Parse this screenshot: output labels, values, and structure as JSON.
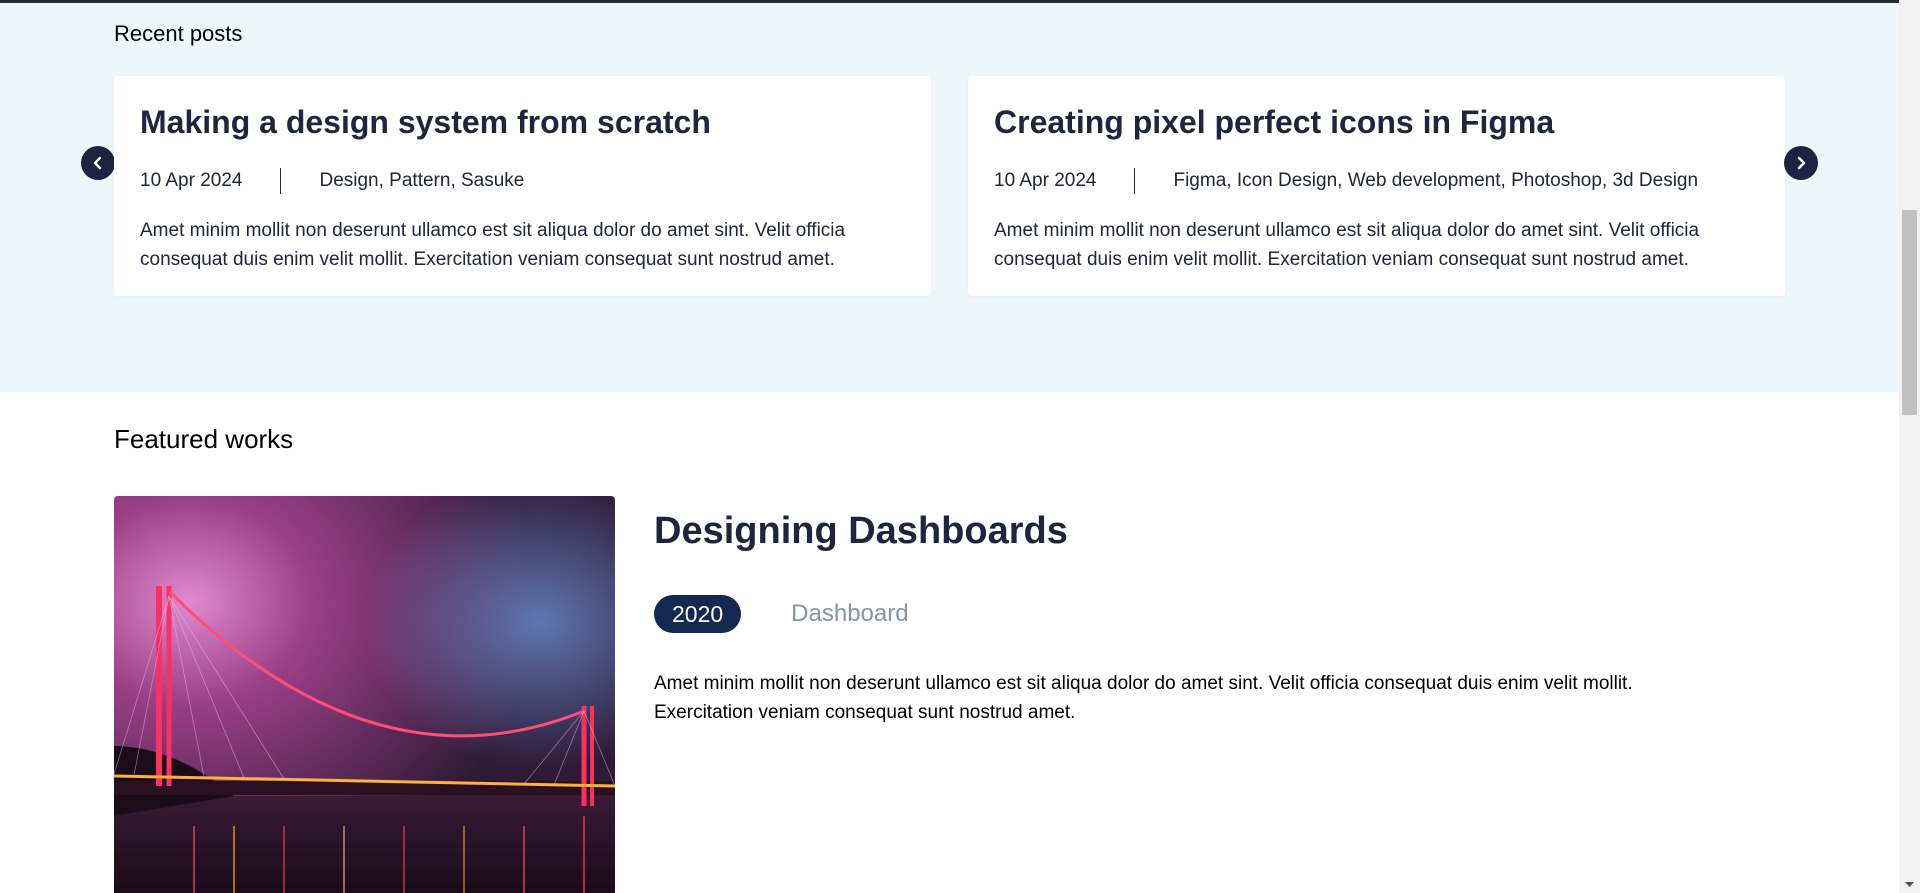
{
  "recent_posts": {
    "heading": "Recent posts",
    "posts": [
      {
        "title": "Making a design system from scratch",
        "date": "10 Apr 2024",
        "tags": "Design, Pattern, Sasuke",
        "excerpt": "Amet minim mollit non deserunt ullamco est sit aliqua dolor do amet sint. Velit officia consequat duis enim velit mollit. Exercitation veniam consequat sunt nostrud amet."
      },
      {
        "title": "Creating pixel perfect icons in Figma",
        "date": "10 Apr 2024",
        "tags": "Figma, Icon Design, Web development, Photoshop, 3d Design",
        "excerpt": "Amet minim mollit non deserunt ullamco est sit aliqua dolor do amet sint. Velit officia consequat duis enim velit mollit. Exercitation veniam consequat sunt nostrud amet."
      }
    ],
    "prev_icon": "chevron-left-icon",
    "next_icon": "chevron-right-icon"
  },
  "featured_works": {
    "heading": "Featured works",
    "items": [
      {
        "title": "Designing Dashboards",
        "year": "2020",
        "category": "Dashboard",
        "description": "Amet minim mollit non deserunt ullamco est sit aliqua dolor do amet sint. Velit officia consequat duis enim velit mollit. Exercitation veniam consequat sunt nostrud amet.",
        "image_subject": "suspension bridge at night with pink and red lights"
      }
    ]
  },
  "colors": {
    "recent_bg": "#edf7fa",
    "text_dark": "#21243d",
    "badge_bg": "#142850",
    "muted": "#8695a4",
    "arrow_bg": "#1d2340"
  }
}
